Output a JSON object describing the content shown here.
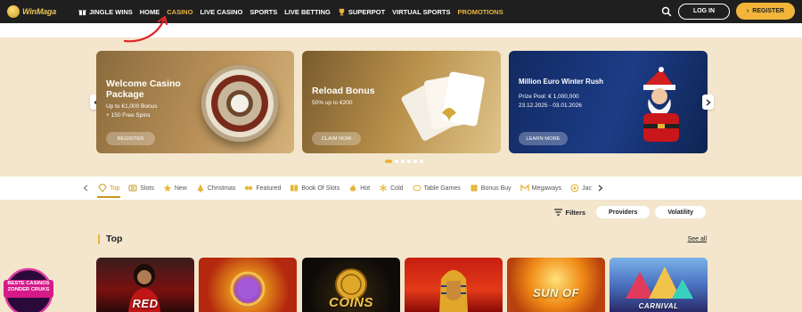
{
  "brand": {
    "logo_text": "WinMaga"
  },
  "nav": {
    "items": [
      {
        "label": "JINGLE WINS",
        "icon": "gift-icon"
      },
      {
        "label": "HOME"
      },
      {
        "label": "CASINO",
        "active": true
      },
      {
        "label": "LIVE CASINO"
      },
      {
        "label": "SPORTS"
      },
      {
        "label": "LIVE BETTING"
      },
      {
        "label": "SUPERPOT",
        "icon": "trophy-icon"
      },
      {
        "label": "VIRTUAL SPORTS"
      },
      {
        "label": "PROMOTIONS"
      }
    ],
    "login_label": "LOG IN",
    "register_label": "REGISTER"
  },
  "banners": [
    {
      "title_line1": "Welcome Casino",
      "title_line2": "Package",
      "text_line1": "Up to €1,000 Bonus",
      "text_line2": "+ 150 Free Spins",
      "button": "REGISTER"
    },
    {
      "title_line1": "Reload Bonus",
      "text_line1": "50% up to €200",
      "button": "CLAIM NOW"
    },
    {
      "title_line1": "Million Euro Winter Rush",
      "text_line1": "Prize Pool: € 1,000,000",
      "text_line2": "23.12.2025 - 03.01.2026",
      "button": "LEARN MORE"
    }
  ],
  "carousel": {
    "slide_count": 6,
    "active_index": 0
  },
  "categories": [
    {
      "label": "Top",
      "icon": "diamond-icon",
      "active": true
    },
    {
      "label": "Slots",
      "icon": "slot-machine-icon"
    },
    {
      "label": "New",
      "icon": "star-icon"
    },
    {
      "label": "Christmas",
      "icon": "tree-icon"
    },
    {
      "label": "Featured",
      "icon": "featured-icon"
    },
    {
      "label": "Book Of Slots",
      "icon": "book-icon"
    },
    {
      "label": "Hot",
      "icon": "flame-icon"
    },
    {
      "label": "Cold",
      "icon": "snowflake-icon"
    },
    {
      "label": "Table Games",
      "icon": "table-icon"
    },
    {
      "label": "Bonus Buy",
      "icon": "clover-icon"
    },
    {
      "label": "Megaways",
      "icon": "megaways-icon"
    },
    {
      "label": "Jac",
      "icon": "jackpot-icon"
    }
  ],
  "filters": {
    "label": "Filters",
    "providers": "Providers",
    "volatility": "Volatility"
  },
  "section": {
    "title": "Top",
    "see_all": "See all"
  },
  "games": [
    {
      "label": "RED"
    },
    {
      "label": ""
    },
    {
      "label": "COINS"
    },
    {
      "label": ""
    },
    {
      "label": "SUN OF"
    },
    {
      "label": "CARNIVAL"
    }
  ],
  "badge": {
    "line1": "BESTE CASINOS",
    "line2": "ZONDER CRUKS"
  },
  "colors": {
    "accent": "#e7b53a",
    "nav_bg": "#1f1f1f",
    "page_bg": "#f3e6cc",
    "annotation": "#e0262a"
  }
}
